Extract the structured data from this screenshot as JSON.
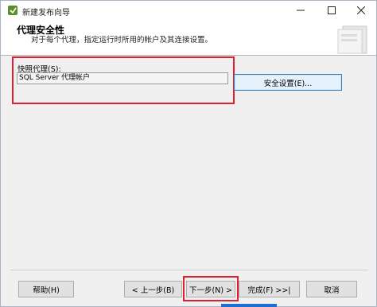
{
  "window": {
    "title": "新建发布向导",
    "minimize_icon": "minimize-icon",
    "maximize_icon": "maximize-icon",
    "close_icon": "close-icon"
  },
  "header": {
    "title": "代理安全性",
    "subtitle": "对于每个代理，指定运行时所用的帐户及其连接设置。"
  },
  "content": {
    "snapshot_label": "快照代理(S):",
    "snapshot_value": "SQL Server 代理帐户",
    "security_button": "安全设置(E)..."
  },
  "footer": {
    "help": "帮助(H)",
    "back": "< 上一步(B)",
    "next": "下一步(N) >",
    "finish": "完成(F) >>|",
    "cancel": "取消"
  },
  "colors": {
    "highlight": "#e02030",
    "accent": "#3c7fb1"
  }
}
